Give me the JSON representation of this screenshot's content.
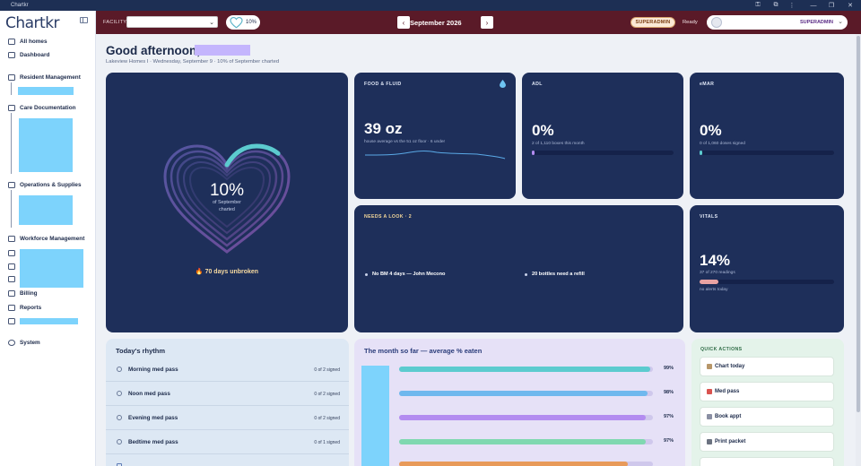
{
  "os": {
    "app_name": "Chartkr"
  },
  "app": {
    "logo": "Chartkr"
  },
  "sidebar": {
    "items": [
      {
        "label": "All homes",
        "icon": "grid-icon"
      },
      {
        "label": "Dashboard",
        "icon": "dashboard-icon"
      },
      {
        "label": "Resident Management",
        "icon": "residents-icon"
      },
      {
        "label": "Care Documentation",
        "icon": "clipboard-icon"
      },
      {
        "label": "Operations & Supplies",
        "icon": "cart-icon"
      },
      {
        "label": "Workforce Management",
        "icon": "briefcase-icon"
      },
      {
        "label": "Billing",
        "icon": "card-icon"
      },
      {
        "label": "Reports",
        "icon": "report-icon"
      },
      {
        "label": "System",
        "icon": "gear-icon"
      }
    ]
  },
  "topbar": {
    "facility_label": "FACILITY",
    "facility_value": "",
    "heart_pct": "10%",
    "month": "September 2026",
    "role_badge": "SUPERADMIN",
    "status": "Ready",
    "user_role": "SUPERADMIN"
  },
  "greeting": {
    "text": "Good afternoon,",
    "subtitle": "Lakeview Homes I · Wednesday, September 9 · 10% of September charted"
  },
  "hero": {
    "pct": "10%",
    "pct_value": 10,
    "caption1": "of September",
    "caption2": "charted",
    "streak": "🔥 70 days unbroken"
  },
  "food": {
    "title": "FOOD & FLUID",
    "value": "39 oz",
    "caption": "house average vs the 51 oz floor · 6 under"
  },
  "adl": {
    "title": "ADL",
    "value": "0%",
    "caption": "2 of 1,110 boxes this month",
    "fill": 0.02
  },
  "emar": {
    "title": "eMAR",
    "value": "0%",
    "caption": "0 of 1,060 doses signed",
    "fill": 0.02
  },
  "needs": {
    "title": "NEEDS A LOOK · 2",
    "items": [
      "No BM 4 days — John Mecono",
      "20 bottles need a refill"
    ]
  },
  "vitals": {
    "title": "VITALS",
    "value": "14%",
    "caption": "37 of 270 readings",
    "footnote": "no alerts today",
    "fill": 0.14
  },
  "rhythm": {
    "title": "Today's rhythm",
    "rows": [
      {
        "label": "Morning med pass",
        "count": "0 of 2 signed"
      },
      {
        "label": "Noon med pass",
        "count": "0 of 2 signed"
      },
      {
        "label": "Evening med pass",
        "count": "0 of 2 signed"
      },
      {
        "label": "Bedtime med pass",
        "count": "0 of 1 signed"
      }
    ]
  },
  "month_so_far": {
    "title": "The month so far — average % eaten",
    "rows": [
      {
        "pct": "99%",
        "value": 0.99,
        "color": "#5ccbcf"
      },
      {
        "pct": "98%",
        "value": 0.98,
        "color": "#6fb8ee"
      },
      {
        "pct": "97%",
        "value": 0.97,
        "color": "#b38cf0"
      },
      {
        "pct": "97%",
        "value": 0.97,
        "color": "#7fd8b0"
      }
    ]
  },
  "quick": {
    "title": "QUICK ACTIONS",
    "buttons": [
      "Chart today",
      "Med pass",
      "Book appt",
      "Print packet"
    ]
  },
  "colors": {
    "topbar": "#5a1a28",
    "card": "#1e2f5a",
    "accent_teal": "#5ccbcf",
    "placeholder": "#7dd3fc"
  }
}
